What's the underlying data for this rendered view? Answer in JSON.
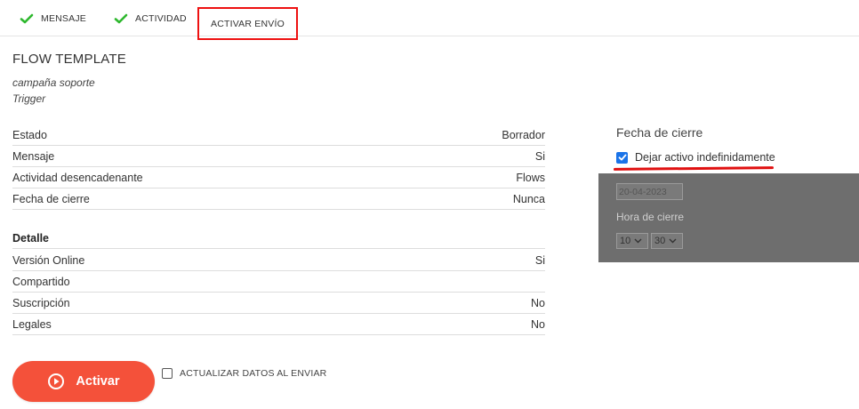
{
  "tabs": [
    {
      "label": "MENSAJE",
      "done": true
    },
    {
      "label": "ACTIVIDAD",
      "done": true
    },
    {
      "label": "ACTIVAR ENVÍO",
      "active": true
    }
  ],
  "header": {
    "title": "FLOW TEMPLATE",
    "subtitle1": "campaña soporte",
    "subtitle2": "Trigger"
  },
  "summary": [
    {
      "label": "Estado",
      "value": "Borrador"
    },
    {
      "label": "Mensaje",
      "value": "Si"
    },
    {
      "label": "Actividad desencadenante",
      "value": "Flows"
    },
    {
      "label": "Fecha de cierre",
      "value": "Nunca"
    }
  ],
  "detail": {
    "heading": "Detalle",
    "rows": [
      {
        "label": "Versión Online",
        "value": "Si"
      },
      {
        "label": "Compartido",
        "value": ""
      },
      {
        "label": "Suscripción",
        "value": "No"
      },
      {
        "label": "Legales",
        "value": "No"
      }
    ]
  },
  "actions": {
    "activar_label": "Activar",
    "actualizar_label": "ACTUALIZAR DATOS AL ENVIAR"
  },
  "closing": {
    "title": "Fecha de cierre",
    "indefinite_label": "Dejar activo indefinidamente",
    "indefinite_checked": true,
    "date_value": "20-04-2023",
    "hora_label": "Hora de cierre",
    "hour_value": "10",
    "minute_value": "30"
  },
  "colors": {
    "accent": "#f4513a",
    "check_green": "#2eb82e",
    "highlight_red": "#e01010",
    "checkbox_blue": "#1a73e8"
  }
}
